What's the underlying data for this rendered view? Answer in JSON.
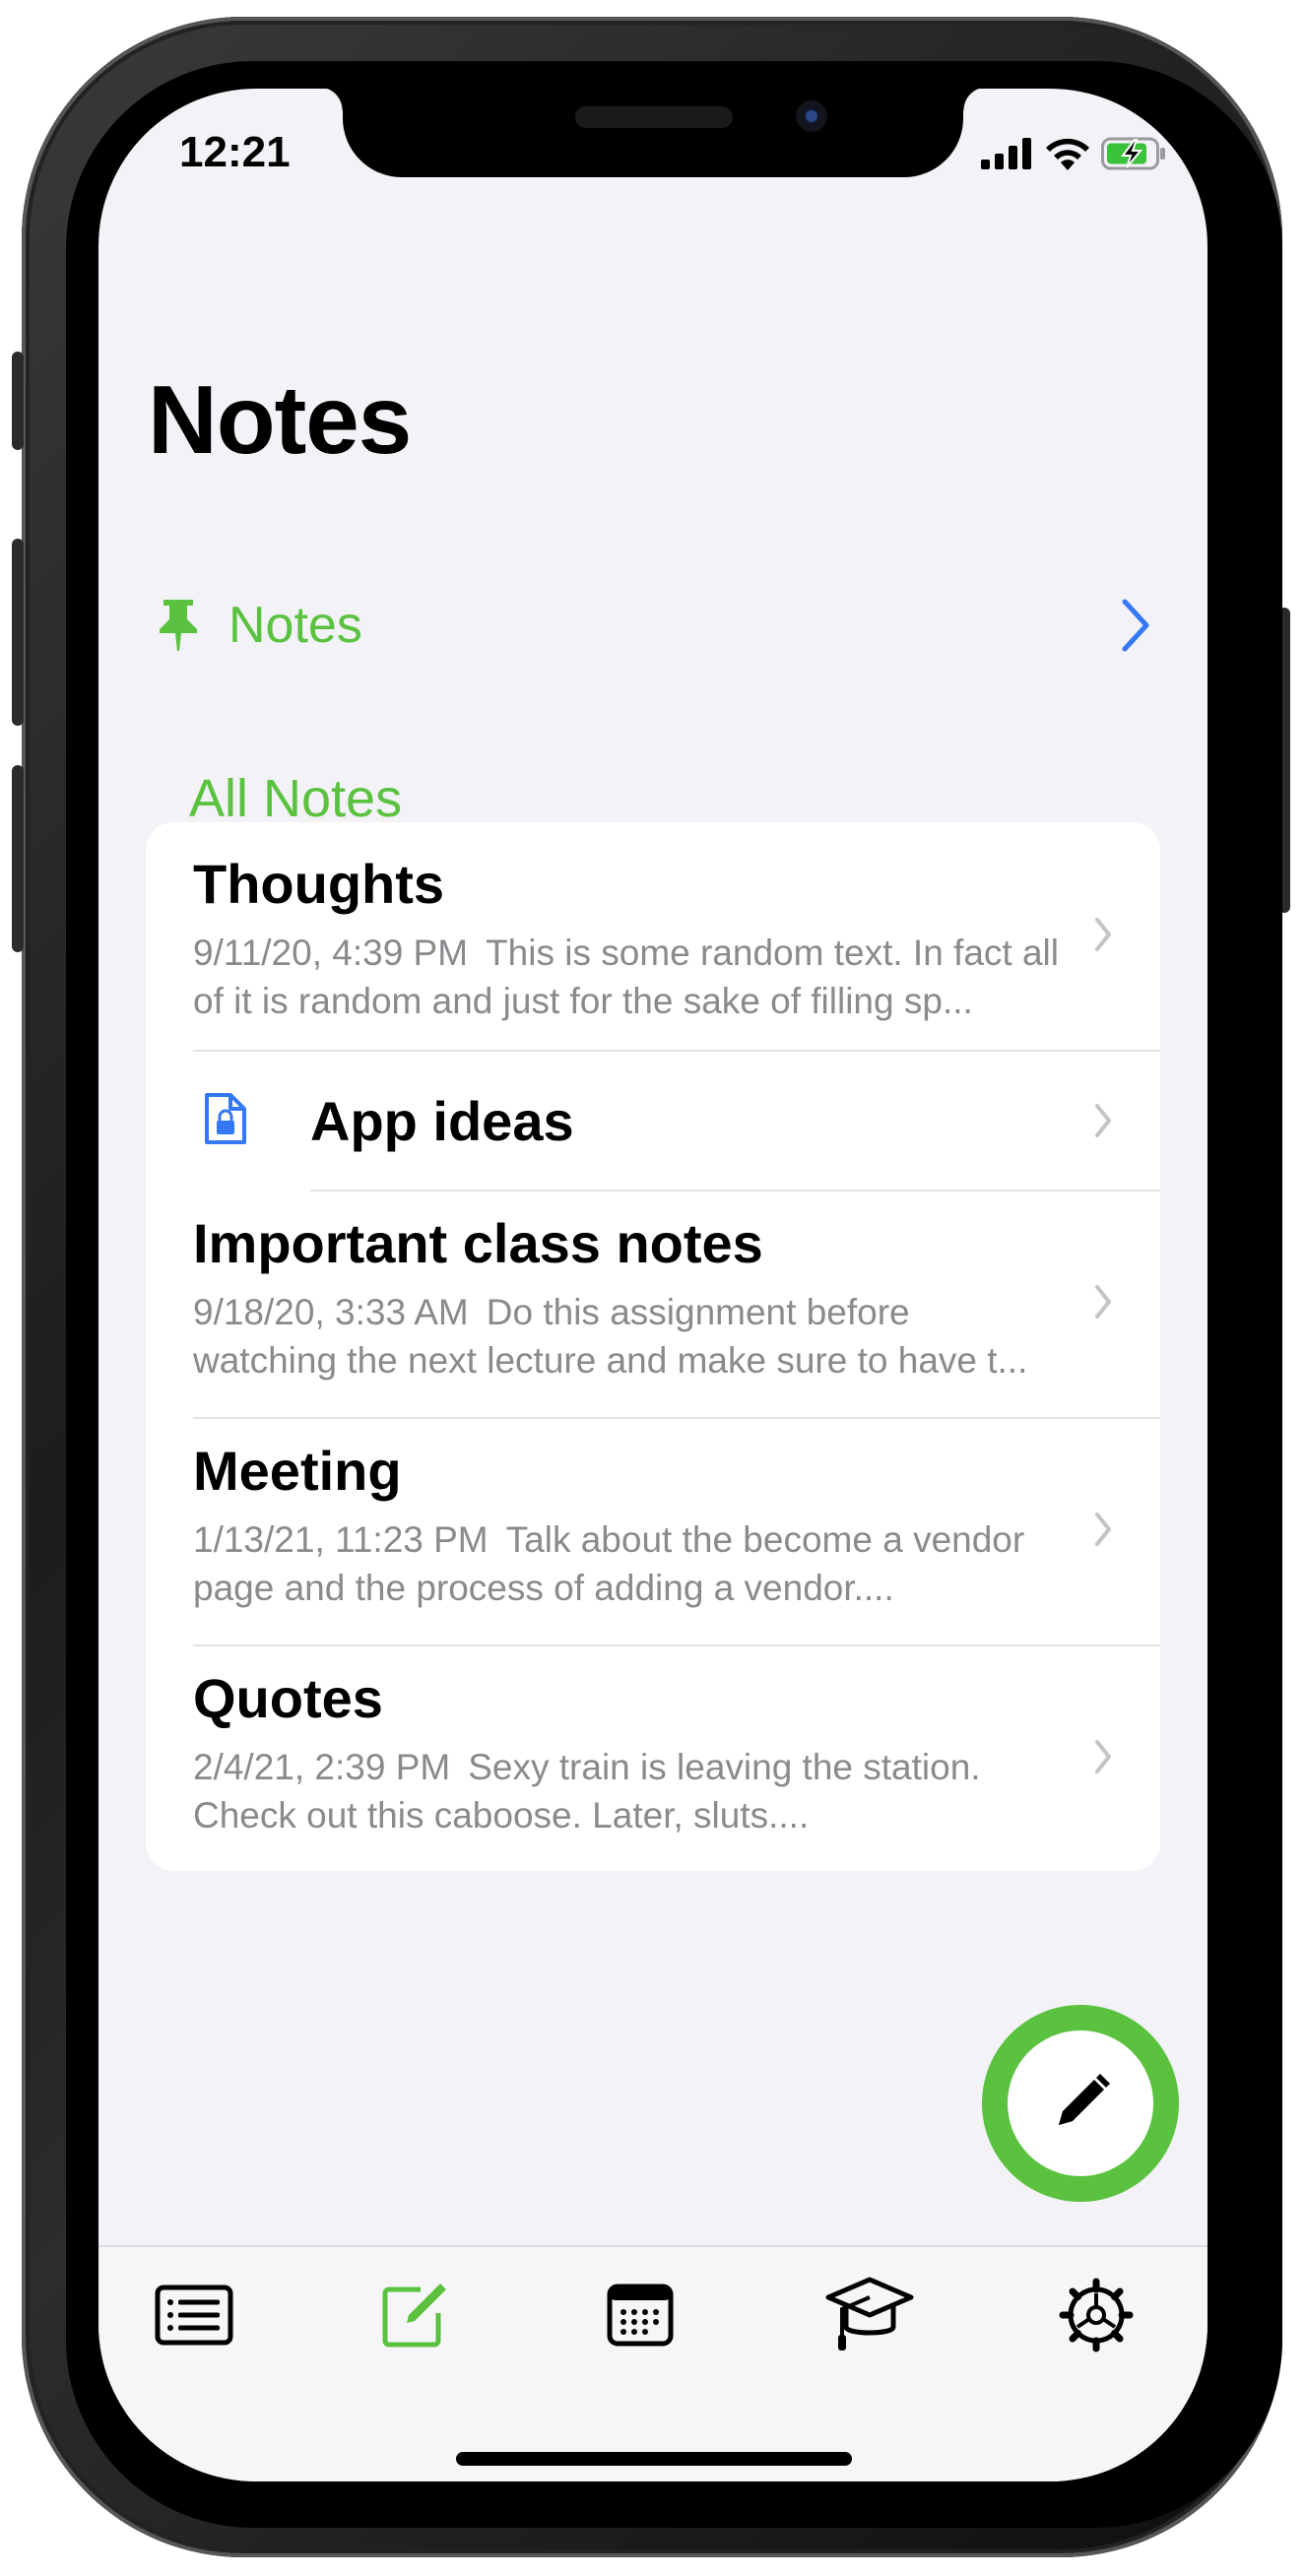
{
  "status_bar": {
    "time": "12:21"
  },
  "header": {
    "title": "Notes"
  },
  "pinned": {
    "label": "Notes"
  },
  "section": {
    "title": "All Notes"
  },
  "notes": [
    {
      "title": "Thoughts",
      "date": "9/11/20, 4:39 PM",
      "preview": "This is some random text. In fact all of it is random and just for the sake of filling sp..."
    },
    {
      "title": "App ideas",
      "locked": true
    },
    {
      "title": "Important class notes",
      "date": "9/18/20, 3:33 AM",
      "preview": "Do this assignment before watching the next lecture and make sure to have t..."
    },
    {
      "title": "Meeting",
      "date": "1/13/21, 11:23 PM",
      "preview": "Talk about the become a vendor page and the process of adding a vendor...."
    },
    {
      "title": "Quotes",
      "date": "2/4/21, 2:39 PM",
      "preview": "Sexy train is leaving the station. Check out this caboose. Later, sluts...."
    }
  ],
  "tabbar": {
    "tabs": [
      {
        "icon": "list-icon",
        "active": false
      },
      {
        "icon": "compose-icon",
        "active": true
      },
      {
        "icon": "calendar-icon",
        "active": false
      },
      {
        "icon": "graduation-cap-icon",
        "active": false
      },
      {
        "icon": "gear-icon",
        "active": false
      }
    ]
  },
  "colors": {
    "accent": "#5ac23f",
    "link": "#3478f6",
    "background": "#f2f2f7"
  }
}
